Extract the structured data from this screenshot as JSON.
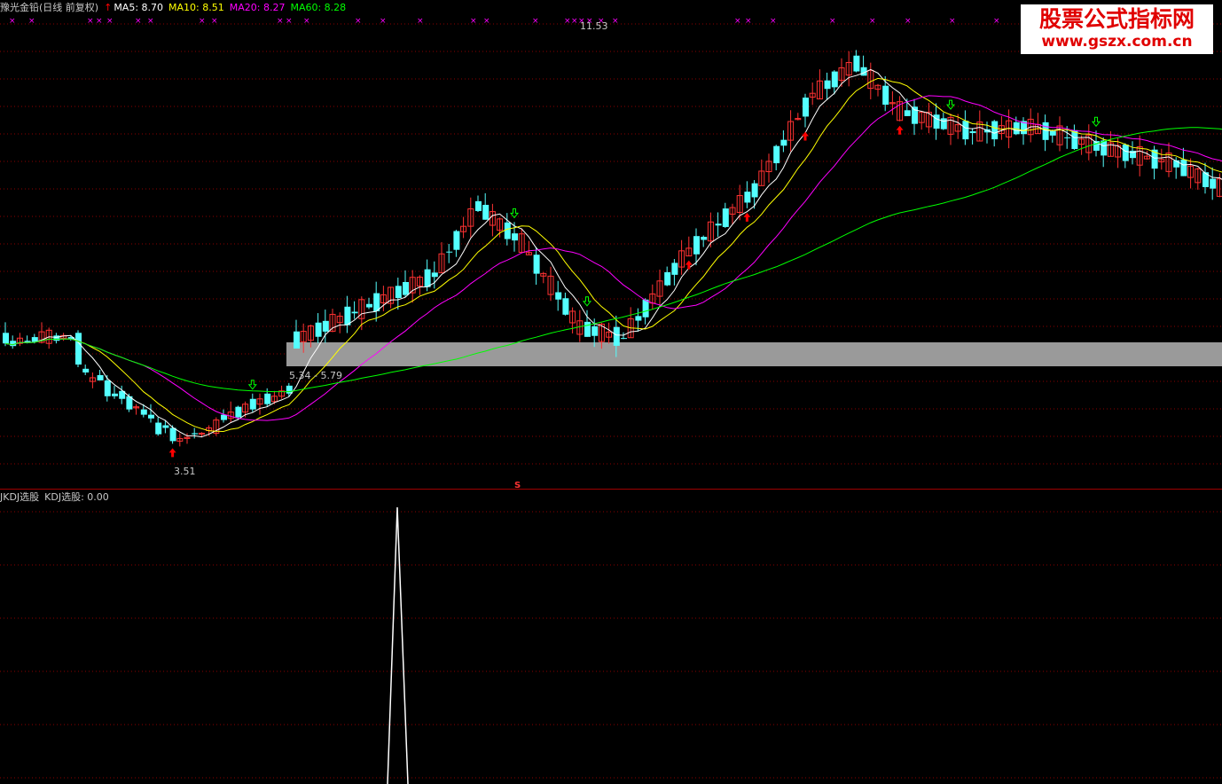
{
  "header": {
    "stock_name": "豫光金铅(日线 前复权)",
    "ma5": "MA5: 8.70",
    "ma10": "MA10: 8.51",
    "ma20": "MA20: 8.27",
    "ma60": "MA60: 8.28"
  },
  "indicator_header": {
    "name": "JKDJ选股",
    "value": "KDJ选股: 0.00"
  },
  "watermark": {
    "title": "股票公式指标网",
    "url": "www.gszx.com.cn"
  },
  "annotations": {
    "high_label": "11.53",
    "low_label": "3.51",
    "zone_label": "5.34 - 5.79",
    "signal_marker": "S"
  },
  "colors": {
    "up": "#ff3232",
    "down": "#54ffff",
    "ma5": "#ffffff",
    "ma10": "#ffff00",
    "ma20": "#ff00ff",
    "ma60": "#00ff00",
    "grid": "#8b0000",
    "zone": "#9a9a9a",
    "buy_arrow": "#ff0000",
    "sell_arrow": "#00ff00"
  },
  "chart_data": [
    {
      "type": "candlestick",
      "title": "豫光金铅(日线 前复权)",
      "series": [
        {
          "name": "K",
          "ohlc": [
            [
              6.1,
              6.3,
              5.85,
              5.9
            ],
            [
              5.95,
              6.05,
              5.8,
              5.85
            ],
            [
              5.9,
              6.1,
              5.85,
              6.0
            ],
            [
              5.95,
              6.05,
              5.9,
              5.92
            ],
            [
              6.02,
              6.08,
              5.9,
              5.93
            ],
            [
              5.92,
              6.3,
              5.9,
              6.12
            ],
            [
              5.9,
              6.2,
              5.8,
              6.15
            ],
            [
              6.05,
              6.1,
              5.9,
              5.95
            ],
            [
              6.0,
              6.1,
              5.95,
              6.05
            ],
            [
              6.02,
              6.05,
              5.95,
              5.98
            ],
            [
              6.1,
              6.15,
              5.45,
              5.5
            ],
            [
              5.42,
              5.5,
              5.3,
              5.35
            ],
            [
              5.18,
              5.35,
              5.05,
              5.25
            ],
            [
              5.3,
              5.4,
              5.2,
              5.2
            ],
            [
              5.2,
              5.3,
              4.8,
              4.9
            ],
            [
              4.95,
              5.1,
              4.85,
              4.9
            ],
            [
              5.0,
              5.1,
              4.75,
              4.85
            ],
            [
              4.9,
              4.95,
              4.6,
              4.65
            ],
            [
              4.68,
              4.75,
              4.55,
              4.7
            ],
            [
              4.65,
              4.75,
              4.5,
              4.55
            ],
            [
              4.55,
              4.75,
              4.4,
              4.48
            ],
            [
              4.4,
              4.5,
              4.15,
              4.18
            ],
            [
              4.35,
              4.45,
              4.2,
              4.3
            ],
            [
              4.3,
              4.35,
              4.0,
              4.05
            ],
            [
              4.05,
              4.2,
              3.95,
              4.1
            ],
            [
              4.1,
              4.2,
              4.0,
              4.12
            ],
            [
              4.2,
              4.3,
              4.1,
              4.18
            ],
            [
              4.18,
              4.22,
              4.12,
              4.2
            ],
            [
              4.25,
              4.35,
              4.15,
              4.3
            ],
            [
              4.2,
              4.5,
              4.15,
              4.45
            ],
            [
              4.55,
              4.65,
              4.4,
              4.45
            ],
            [
              4.48,
              4.8,
              4.4,
              4.6
            ],
            [
              4.7,
              4.72,
              4.45,
              4.5
            ],
            [
              4.6,
              4.8,
              4.5,
              4.75
            ],
            [
              4.85,
              4.95,
              4.6,
              4.65
            ],
            [
              4.75,
              4.95,
              4.55,
              4.85
            ],
            [
              4.95,
              5.05,
              4.7,
              4.75
            ],
            [
              4.8,
              5.0,
              4.75,
              4.9
            ],
            [
              4.9,
              5.1,
              4.85,
              5.0
            ],
            [
              5.1,
              5.15,
              4.9,
              4.95
            ]
          ]
        }
      ],
      "ma_lines": [
        "MA5",
        "MA10",
        "MA20",
        "MA60"
      ],
      "price_high": 11.53,
      "price_low": 3.51,
      "support_zone": [
        5.34,
        5.79
      ],
      "ylim": [
        3.2,
        12.0
      ],
      "grid": true
    },
    {
      "type": "line",
      "title": "JKDJ选股",
      "series": [
        {
          "name": "KDJ选股",
          "peak_value": 1,
          "current_value": 0.0
        }
      ],
      "ylim": [
        0,
        1
      ]
    }
  ]
}
